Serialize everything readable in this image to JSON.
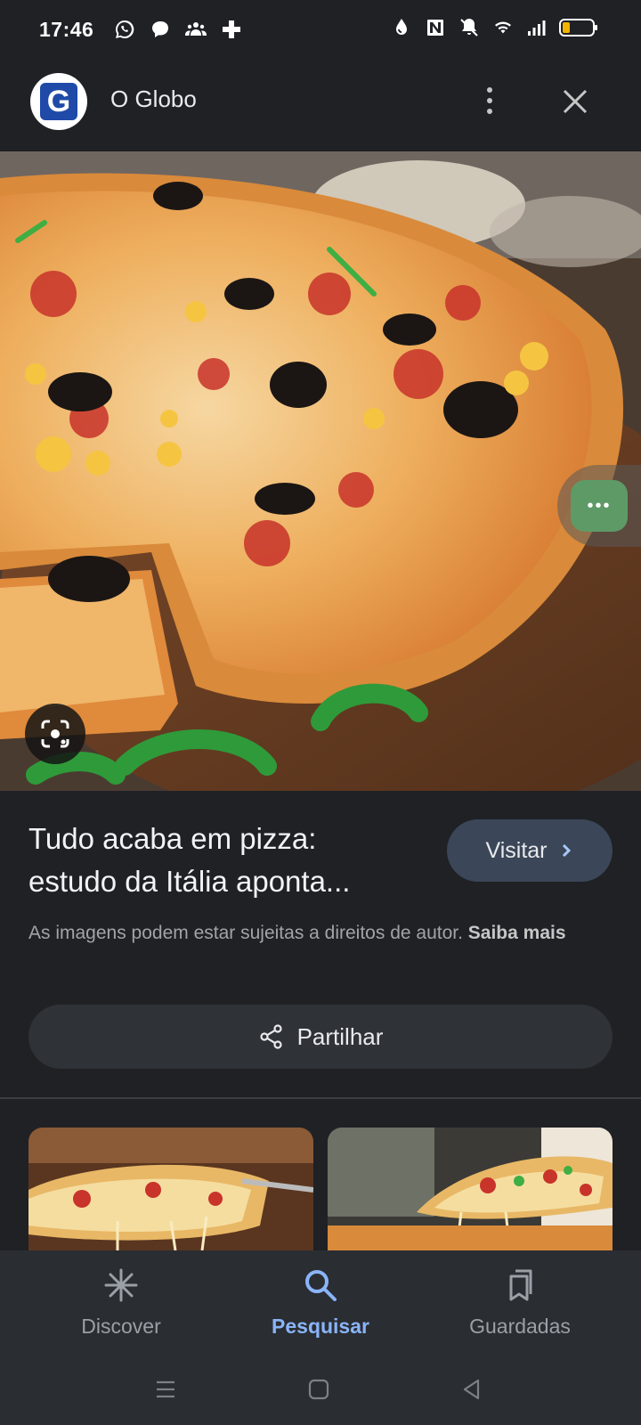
{
  "status_bar": {
    "time": "17:46",
    "left_icons": [
      "whatsapp-icon",
      "chat-bubble-icon",
      "group-icon",
      "gamepad-icon"
    ],
    "right_icons": [
      "water-drop-icon",
      "nfc-icon",
      "mute-icon",
      "wifi-icon",
      "signal-icon",
      "battery-icon"
    ],
    "battery_level": 0.25
  },
  "header": {
    "source_logo_letter": "G",
    "source_name": "O Globo"
  },
  "result": {
    "title": "Tudo acaba em pizza: estudo da Itália aponta...",
    "visit_label": "Visitar",
    "copyright_text": "As imagens podem estar sujeitas a direitos de autor.",
    "learn_more": "Saiba mais",
    "share_label": "Partilhar"
  },
  "bottom_nav": {
    "items": [
      {
        "label": "Discover",
        "icon": "asterisk-icon",
        "active": false
      },
      {
        "label": "Pesquisar",
        "icon": "search-icon",
        "active": true
      },
      {
        "label": "Guardadas",
        "icon": "bookmarks-icon",
        "active": false
      }
    ]
  },
  "colors": {
    "background": "#1f2125",
    "accent": "#8ab4f8",
    "visit_button": "#3b4658"
  }
}
